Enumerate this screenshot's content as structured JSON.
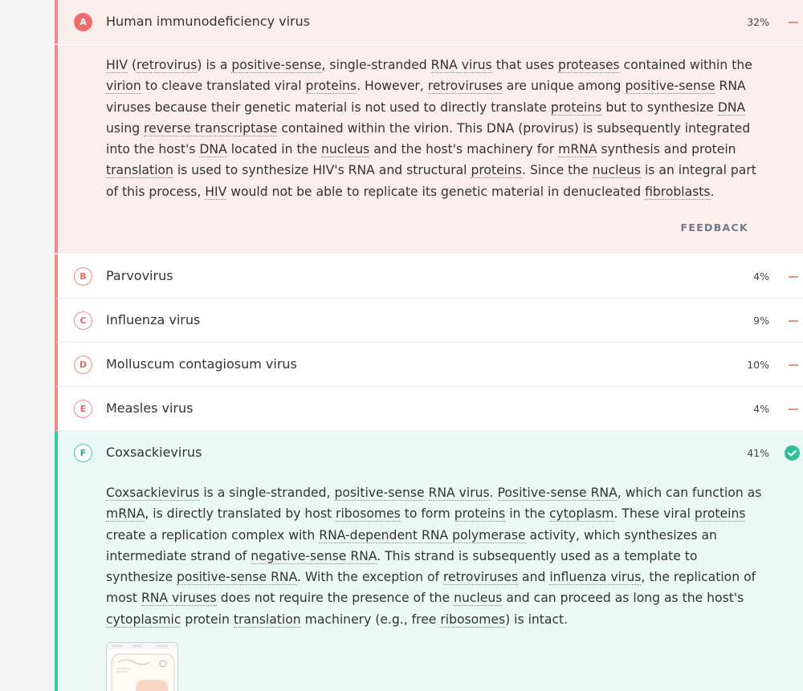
{
  "options": [
    {
      "letter": "A",
      "label": "Human immunodeficiency virus",
      "pct": "32%"
    },
    {
      "letter": "B",
      "label": "Parvovirus",
      "pct": "4%"
    },
    {
      "letter": "C",
      "label": "Influenza virus",
      "pct": "9%"
    },
    {
      "letter": "D",
      "label": "Molluscum contagiosum virus",
      "pct": "10%"
    },
    {
      "letter": "E",
      "label": "Measles virus",
      "pct": "4%"
    },
    {
      "letter": "F",
      "label": "Coxsackievirus",
      "pct": "41%"
    }
  ],
  "explanation_a": {
    "segments": [
      {
        "t": "HIV",
        "u": true
      },
      {
        "t": " ("
      },
      {
        "t": "retrovirus",
        "u": true
      },
      {
        "t": ") is a "
      },
      {
        "t": "positive-sense",
        "u": true
      },
      {
        "t": ", single-stranded "
      },
      {
        "t": "RNA virus",
        "u": true
      },
      {
        "t": " that uses "
      },
      {
        "t": "proteases",
        "u": true
      },
      {
        "t": " contained within the "
      },
      {
        "t": "virion",
        "u": true
      },
      {
        "t": " to cleave translated viral "
      },
      {
        "t": "proteins",
        "u": true
      },
      {
        "t": ". However, "
      },
      {
        "t": "retroviruses",
        "u": true
      },
      {
        "t": " are unique among "
      },
      {
        "t": "positive-sense",
        "u": true
      },
      {
        "t": " RNA viruses because their genetic material is not used to directly translate "
      },
      {
        "t": "proteins",
        "u": true
      },
      {
        "t": " but to synthesize "
      },
      {
        "t": "DNA",
        "u": true
      },
      {
        "t": " using "
      },
      {
        "t": "reverse transcriptase",
        "u": true
      },
      {
        "t": " contained within the virion. This DNA (provirus) is subsequently integrated into the host's "
      },
      {
        "t": "DNA",
        "u": true
      },
      {
        "t": " located in the "
      },
      {
        "t": "nucleus",
        "u": true
      },
      {
        "t": " and the host's machinery for "
      },
      {
        "t": "mRNA",
        "u": true
      },
      {
        "t": " synthesis and protein "
      },
      {
        "t": "translation",
        "u": true
      },
      {
        "t": " is used to synthesize HIV's RNA and structural "
      },
      {
        "t": "proteins",
        "u": true
      },
      {
        "t": ". Since the "
      },
      {
        "t": "nucleus",
        "u": true
      },
      {
        "t": " is an integral part of this process, "
      },
      {
        "t": "HIV",
        "u": true
      },
      {
        "t": " would not be able to replicate its genetic material in denucleated "
      },
      {
        "t": "fibroblasts",
        "u": true
      },
      {
        "t": "."
      }
    ],
    "feedback_label": "FEEDBACK"
  },
  "explanation_f": {
    "segments": [
      {
        "t": "Coxsackievirus",
        "u": true
      },
      {
        "t": " is a single-stranded, "
      },
      {
        "t": "positive-sense",
        "u": true
      },
      {
        "t": " "
      },
      {
        "t": "RNA virus",
        "u": true
      },
      {
        "t": ". "
      },
      {
        "t": "Positive-sense RNA",
        "u": true
      },
      {
        "t": ", which can function as "
      },
      {
        "t": "mRNA",
        "u": true
      },
      {
        "t": ", is directly translated by host "
      },
      {
        "t": "ribosomes",
        "u": true
      },
      {
        "t": " to form "
      },
      {
        "t": "proteins",
        "u": true
      },
      {
        "t": " in the "
      },
      {
        "t": "cytoplasm",
        "u": true
      },
      {
        "t": ". These viral "
      },
      {
        "t": "proteins",
        "u": true
      },
      {
        "t": " create a replication complex with "
      },
      {
        "t": "RNA-dependent RNA polymerase",
        "u": true
      },
      {
        "t": " activity, which synthesizes an intermediate strand of "
      },
      {
        "t": "negative-sense RNA",
        "u": true
      },
      {
        "t": ". This strand is subsequently used as a template to synthesize "
      },
      {
        "t": "positive-sense RNA",
        "u": true
      },
      {
        "t": ". With the exception of "
      },
      {
        "t": "retroviruses",
        "u": true
      },
      {
        "t": " and "
      },
      {
        "t": "influenza virus",
        "u": true
      },
      {
        "t": ", the replication of most "
      },
      {
        "t": "RNA viruses",
        "u": true
      },
      {
        "t": " does not require the presence of the "
      },
      {
        "t": "nucleus",
        "u": true
      },
      {
        "t": " and can proceed as long as the host's "
      },
      {
        "t": "cytoplasmic",
        "u": true
      },
      {
        "t": " protein "
      },
      {
        "t": "translation",
        "u": true
      },
      {
        "t": " machinery (e.g., free "
      },
      {
        "t": "ribosomes",
        "u": true
      },
      {
        "t": ") is intact."
      }
    ]
  },
  "colors": {
    "wrong": "#f08a8a",
    "correct": "#3cc7a4"
  },
  "icons": {
    "correct": "check-circle-icon",
    "wrong": "minus-icon"
  }
}
